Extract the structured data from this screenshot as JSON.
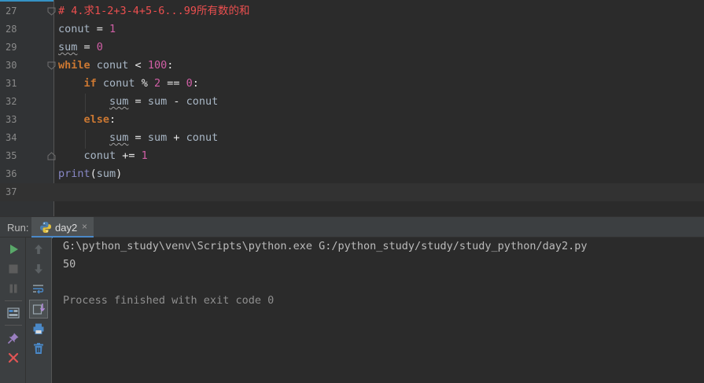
{
  "editor": {
    "lines": [
      {
        "num": "27",
        "tokens": [
          {
            "t": "# 4.求1-2+3-4+5-6...99所有数的和",
            "c": "str-cmt"
          }
        ]
      },
      {
        "num": "28",
        "tokens": [
          {
            "t": "conut",
            "c": "id"
          },
          {
            "t": " = ",
            "c": "op"
          },
          {
            "t": "1",
            "c": "num"
          }
        ]
      },
      {
        "num": "29",
        "tokens": [
          {
            "t": "sum",
            "c": "id warn-u"
          },
          {
            "t": " = ",
            "c": "op"
          },
          {
            "t": "0",
            "c": "num"
          }
        ]
      },
      {
        "num": "30",
        "tokens": [
          {
            "t": "while",
            "c": "kw"
          },
          {
            "t": " conut ",
            "c": "id"
          },
          {
            "t": "<",
            "c": "op"
          },
          {
            "t": " ",
            "c": "id"
          },
          {
            "t": "100",
            "c": "num"
          },
          {
            "t": ":",
            "c": "op"
          }
        ]
      },
      {
        "num": "31",
        "tokens": [
          {
            "t": "    ",
            "c": "id"
          },
          {
            "t": "if",
            "c": "kw"
          },
          {
            "t": " conut ",
            "c": "id"
          },
          {
            "t": "%",
            "c": "op"
          },
          {
            "t": " ",
            "c": "id"
          },
          {
            "t": "2",
            "c": "num"
          },
          {
            "t": " == ",
            "c": "op"
          },
          {
            "t": "0",
            "c": "num"
          },
          {
            "t": ":",
            "c": "op"
          }
        ]
      },
      {
        "num": "32",
        "tokens": [
          {
            "t": "        ",
            "c": "id"
          },
          {
            "t": "sum",
            "c": "id warn-u"
          },
          {
            "t": " = ",
            "c": "op"
          },
          {
            "t": "sum",
            "c": "id"
          },
          {
            "t": " - ",
            "c": "op"
          },
          {
            "t": "conut",
            "c": "id"
          }
        ]
      },
      {
        "num": "33",
        "tokens": [
          {
            "t": "    ",
            "c": "id"
          },
          {
            "t": "else",
            "c": "kw"
          },
          {
            "t": ":",
            "c": "op"
          }
        ]
      },
      {
        "num": "34",
        "tokens": [
          {
            "t": "        ",
            "c": "id"
          },
          {
            "t": "sum",
            "c": "id warn-u"
          },
          {
            "t": " = ",
            "c": "op"
          },
          {
            "t": "sum",
            "c": "id"
          },
          {
            "t": " + ",
            "c": "op"
          },
          {
            "t": "conut",
            "c": "id"
          }
        ]
      },
      {
        "num": "35",
        "tokens": [
          {
            "t": "    ",
            "c": "id"
          },
          {
            "t": "conut",
            "c": "id"
          },
          {
            "t": " += ",
            "c": "op"
          },
          {
            "t": "1",
            "c": "num"
          }
        ]
      },
      {
        "num": "36",
        "tokens": [
          {
            "t": "print",
            "c": "fn"
          },
          {
            "t": "(",
            "c": "op"
          },
          {
            "t": "sum",
            "c": "id"
          },
          {
            "t": ")",
            "c": "op"
          }
        ]
      },
      {
        "num": "37",
        "tokens": []
      }
    ],
    "current_line_index": 10
  },
  "run_panel": {
    "label": "Run:",
    "tab": {
      "name": "day2",
      "icon": "python-icon",
      "close": "×"
    },
    "console": {
      "command": "G:\\python_study\\venv\\Scripts\\python.exe G:/python_study/study/study_python/day2.py",
      "output": "50",
      "exit_message": "Process finished with exit code 0"
    },
    "toolbar_left": [
      "rerun-icon",
      "stop-icon",
      "pause-icon",
      "layout-icon",
      "pin-icon",
      "close-icon"
    ],
    "toolbar_right": [
      "up-icon",
      "down-icon",
      "soft-wrap-icon",
      "scroll-to-end-icon",
      "print-icon",
      "trash-icon"
    ]
  },
  "colors": {
    "background": "#2b2b2b",
    "keyword": "#cc7832",
    "number": "#d15fa6",
    "comment": "#ec4f4f",
    "builtin": "#8888c6",
    "run_green": "#59a869",
    "close_red": "#e05555",
    "accent_blue": "#4a88c7"
  }
}
